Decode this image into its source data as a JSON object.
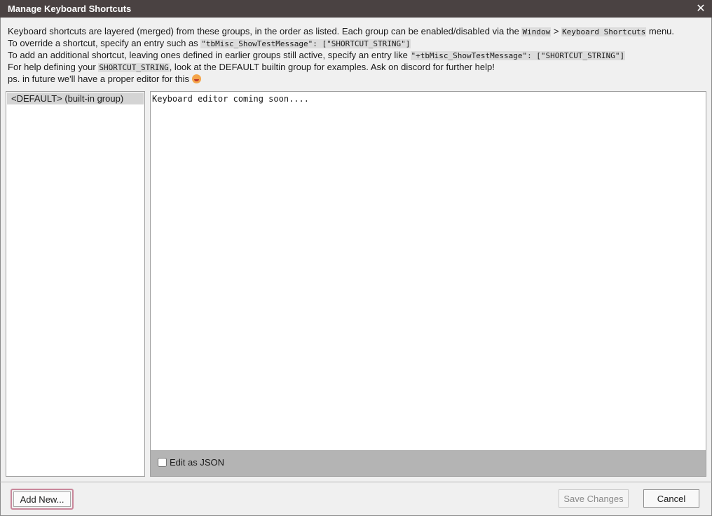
{
  "window": {
    "title": "Manage Keyboard Shortcuts",
    "close_glyph": "✕"
  },
  "info": {
    "line1": {
      "text_a": "Keyboard shortcuts are layered (merged) from these groups, in the order as listed. Each group can be enabled/disabled via the ",
      "code_a": "Window",
      "text_b": " > ",
      "code_b": "Keyboard Shortcuts",
      "text_c": " menu."
    },
    "line2": {
      "text_a": "To override a shortcut, specify an entry such as ",
      "code_a": "\"tbMisc_ShowTestMessage\": [\"SHORTCUT_STRING\"]"
    },
    "line3": {
      "text_a": "To add an additional shortcut, leaving ones defined in earlier groups still active, specify an entry like ",
      "code_a": "\"+tbMisc_ShowTestMessage\": [\"SHORTCUT_STRING\"]"
    },
    "line4": {
      "text_a": "For help defining your ",
      "code_a": "SHORTCUT_STRING",
      "text_b": ", look at the DEFAULT builtin group for examples. Ask on discord for further help!"
    },
    "line5": {
      "text_a": "ps. in future we'll have a proper editor for this ",
      "emoji_icon": "smiling-face-emoji-icon"
    }
  },
  "groups": {
    "items": [
      "<DEFAULT> (built-in group)"
    ],
    "selected_index": 0
  },
  "editor": {
    "content": "Keyboard editor coming soon....",
    "edit_as_json_label": "Edit as JSON",
    "edit_as_json_checked": false
  },
  "buttons": {
    "add_new": "Add New...",
    "save_changes": "Save Changes",
    "cancel": "Cancel"
  },
  "colors": {
    "titlebar": "#4a4242",
    "selected_item": "#d4d4d4",
    "editor_footer": "#b4b4b4",
    "focus_ring": "#c9879b"
  }
}
